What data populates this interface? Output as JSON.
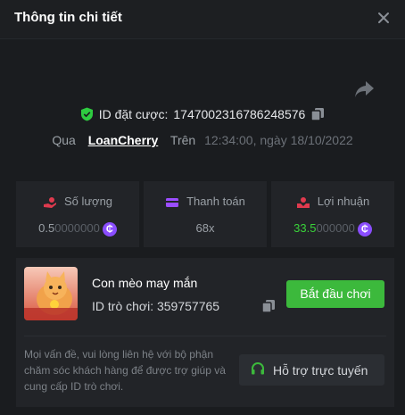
{
  "header": {
    "title": "Thông tin chi tiết"
  },
  "bet": {
    "id_label": "ID đặt cược:",
    "id_value": "1747002316786248576"
  },
  "via": {
    "label": "Qua",
    "username": "LoanCherry",
    "on_label": "Trên",
    "datetime": "12:34:00, ngày 18/10/2022"
  },
  "stats": [
    {
      "label": "Số lượng",
      "value_main": "0.5",
      "value_tail": "0000000",
      "icon": "coins-hand-icon",
      "coin": "₵"
    },
    {
      "label": "Thanh toán",
      "value": "68x",
      "icon": "card-icon"
    },
    {
      "label": "Lợi nhuận",
      "value_main": "33.5",
      "value_tail": "000000",
      "icon": "profit-icon",
      "coin": "₵"
    }
  ],
  "game": {
    "name": "Con mèo may mắn",
    "id_label": "ID trò chơi:",
    "id_value": "359757765",
    "thumb_text": "LUCKY CAT",
    "play_label": "Bắt đầu chơi"
  },
  "help": {
    "text": "Mọi vấn đề, vui lòng liên hệ với bộ phận chăm sóc khách hàng để được trợ giúp và cung cấp ID trò chơi.",
    "support_label": "Hỗ trợ trực tuyến"
  },
  "colors": {
    "accent_green": "#3cb93c",
    "profit_green": "#3ad33a",
    "coin_purple": "#8a4dff",
    "shield_green": "#2ecc40"
  }
}
